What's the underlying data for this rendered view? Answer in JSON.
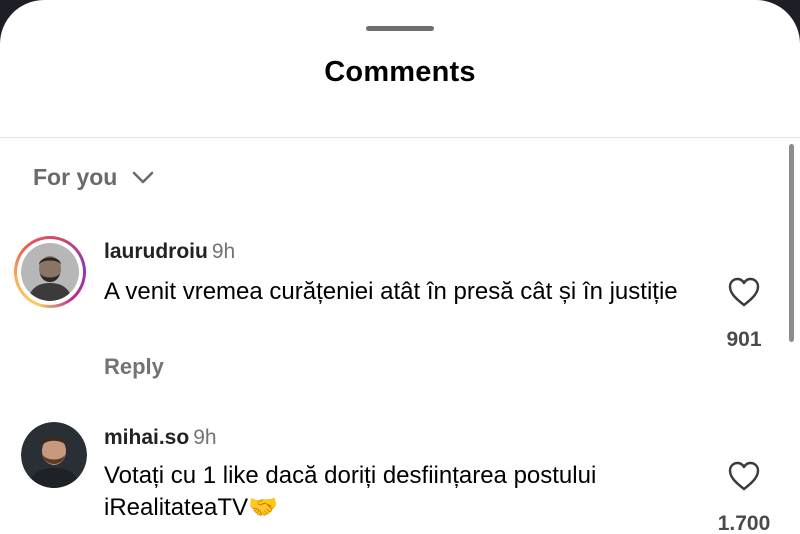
{
  "sheet": {
    "title": "Comments"
  },
  "sort": {
    "label": "For you",
    "icon": "chevron-down-icon"
  },
  "comments": [
    {
      "username": "laurudroiu",
      "time": "9h",
      "text": "A venit vremea curățeniei atât în presă cât și în justiție",
      "reply_label": "Reply",
      "likes": "901",
      "has_story_ring": true
    },
    {
      "username": "mihai.so",
      "time": "9h",
      "text": "Votați cu 1 like dacă doriți desființarea postului iRealitateaTV🤝",
      "likes": "1.700",
      "has_story_ring": false
    }
  ],
  "colors": {
    "background_dark": "#1c1f26",
    "sheet": "#ffffff",
    "secondary_text": "#737373",
    "story_ring_gradient": [
      "#fccc63",
      "#fbad50",
      "#e95950",
      "#cd486b",
      "#8a3ab9"
    ]
  }
}
